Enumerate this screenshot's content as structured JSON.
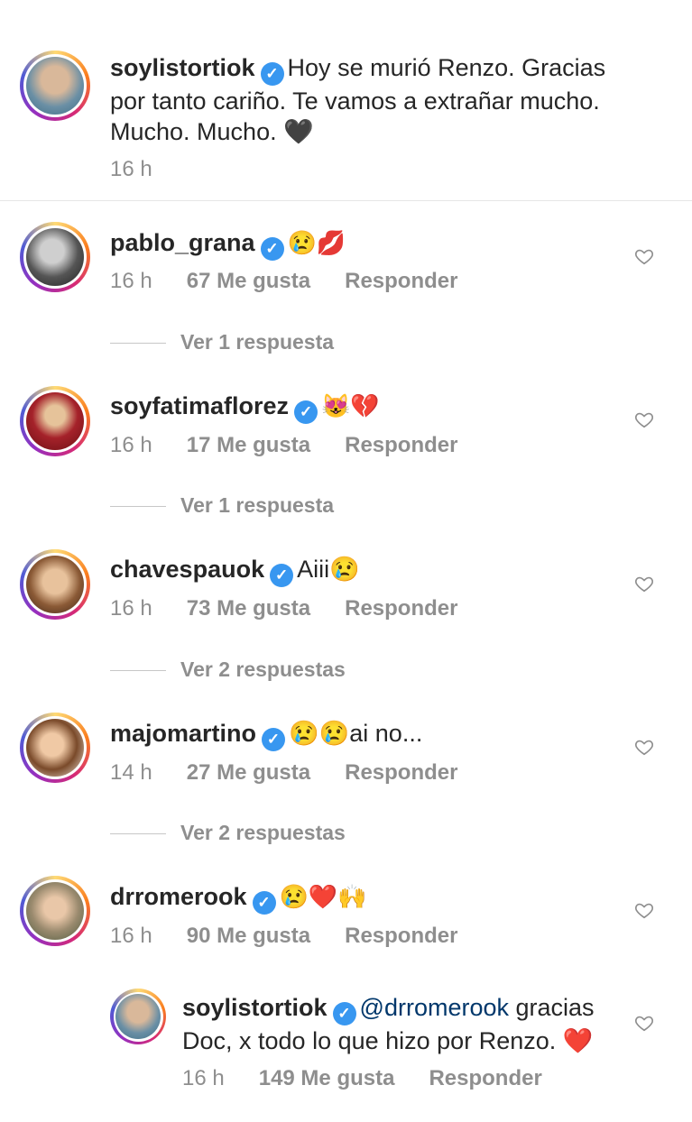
{
  "post": {
    "username": "soylistortiok",
    "text_lines": [
      "Hoy se murió Renzo. Gracias",
      "por tanto cariño. Te vamos a extrañar mucho.",
      "Mucho. Mucho. 🖤"
    ],
    "time": "16 h"
  },
  "comments": [
    {
      "username": "pablo_grana",
      "text": "😢💋",
      "time": "16 h",
      "likes": "67 Me gusta",
      "reply": "Responder",
      "view_replies": "Ver 1 respuesta"
    },
    {
      "username": "soyfatimaflorez",
      "text": "😻💔",
      "time": "16 h",
      "likes": "17 Me gusta",
      "reply": "Responder",
      "view_replies": "Ver 1 respuesta"
    },
    {
      "username": "chavespauok",
      "text": "Aiii😢",
      "time": "16 h",
      "likes": "73 Me gusta",
      "reply": "Responder",
      "view_replies": "Ver 2 respuestas"
    },
    {
      "username": "majomartino",
      "text": "😢😢ai no...",
      "time": "14 h",
      "likes": "27 Me gusta",
      "reply": "Responder",
      "view_replies": "Ver 2 respuestas"
    },
    {
      "username": "drromerook",
      "text": "😢❤️🙌",
      "time": "16 h",
      "likes": "90 Me gusta",
      "reply": "Responder"
    }
  ],
  "reply": {
    "username": "soylistortiok",
    "mention": "@drromerook",
    "text_line1_rest": " gracias",
    "text_line2": "Doc, x todo lo que hizo por Renzo. ❤️",
    "time": "16 h",
    "likes": "149 Me gusta",
    "reply": "Responder"
  },
  "icons": {
    "verified": "verified-badge-icon",
    "like": "heart-outline-icon"
  },
  "colors": {
    "verified": "#3897f0",
    "secondary_text": "#8e8e8e",
    "mention": "#00376b"
  }
}
